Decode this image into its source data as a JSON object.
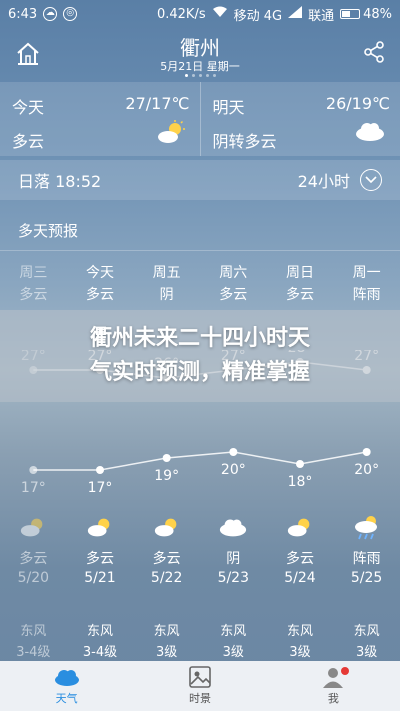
{
  "status_bar": {
    "time": "6:43",
    "speed": "0.42K/s",
    "carrier1": "移动 4G",
    "carrier2": "联通",
    "battery": "48%",
    "battery_level": 0.48
  },
  "header": {
    "city": "衢州",
    "date": "5月21日 星期一",
    "page_dots": 5,
    "active_dot": 0
  },
  "today": {
    "label": "今天",
    "temp": "27/17℃",
    "desc": "多云",
    "icon": "partly-cloudy-icon"
  },
  "tomorrow": {
    "label": "明天",
    "temp": "26/19℃",
    "desc": "阴转多云",
    "icon": "cloud-icon"
  },
  "sunset": {
    "label": "日落 18:52",
    "hours_label": "24小时"
  },
  "forecast": {
    "title": "多天预报",
    "days": [
      {
        "name": "周三",
        "cond": "多云",
        "night_cond": "多云",
        "date": "5/20",
        "high": 27,
        "low": 17,
        "wind": "东风",
        "wind_level": "3-4级",
        "icon": "partly-cloudy-icon"
      },
      {
        "name": "今天",
        "cond": "多云",
        "night_cond": "多云",
        "date": "5/21",
        "high": 27,
        "low": 17,
        "wind": "东风",
        "wind_level": "3-4级",
        "icon": "partly-cloudy-icon"
      },
      {
        "name": "周五",
        "cond": "阴",
        "night_cond": "多云",
        "date": "5/22",
        "high": 26,
        "low": 19,
        "wind": "东风",
        "wind_level": "3级",
        "icon": "partly-cloudy-icon"
      },
      {
        "name": "周六",
        "cond": "多云",
        "night_cond": "阴",
        "date": "5/23",
        "high": 27,
        "low": 20,
        "wind": "东风",
        "wind_level": "3级",
        "icon": "cloud-icon"
      },
      {
        "name": "周日",
        "cond": "多云",
        "night_cond": "多云",
        "date": "5/24",
        "high": 28,
        "low": 18,
        "wind": "东风",
        "wind_level": "3级",
        "icon": "partly-cloudy-icon"
      },
      {
        "name": "周一",
        "cond": "阵雨",
        "night_cond": "阵雨",
        "date": "5/25",
        "high": 27,
        "low": 20,
        "wind": "东风",
        "wind_level": "3级",
        "icon": "rain-icon"
      }
    ]
  },
  "banner": {
    "line1": "衢州未来二十四小时天",
    "line2": "气实时预测，精准掌握"
  },
  "tabs": [
    {
      "label": "天气",
      "icon": "cloud-tab-icon",
      "active": true
    },
    {
      "label": "时景",
      "icon": "photo-tab-icon",
      "active": false
    },
    {
      "label": "我",
      "icon": "person-tab-icon",
      "active": false
    }
  ],
  "colors": {
    "accent": "#2a8ee0",
    "badge": "#e53935"
  }
}
